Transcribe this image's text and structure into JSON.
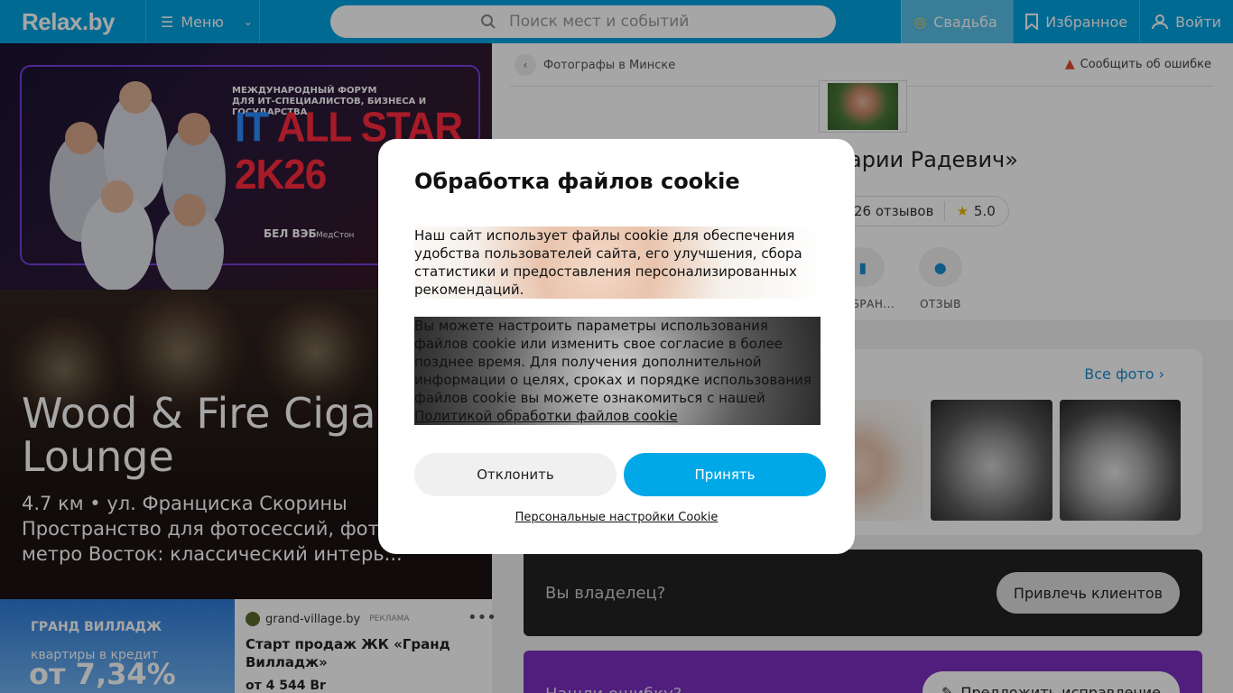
{
  "header": {
    "logo": "Relax.by",
    "menu_label": "Меню",
    "search_placeholder": "Поиск мест и событий",
    "wedding_label": "Свадьба",
    "favorites_label": "Избранное",
    "login_label": "Войти"
  },
  "banner": {
    "forum_line1": "МЕЖДУНАРОДНЫЙ ФОРУМ",
    "forum_line2": "ДЛЯ ИТ-СПЕЦИАЛИСТОВ, БИЗНЕСА И ГОСУДАРСТВА",
    "headline_it": "IT",
    "headline_rest": " ALL STAR 2K26",
    "sponsor": "БЕЛ ВЭБ",
    "sponsor2": "МедСтон"
  },
  "place": {
    "title": "Wood & Fire Cigar Lounge",
    "distance_address": "4.7 км • ул. Франциска Скорины",
    "description": "Пространство для фотосессий, фото возле метро Восток: классический интерь..."
  },
  "ad": {
    "image_brand": "ГРАНД ВИЛЛАДЖ",
    "image_credit": "квартиры в кредит",
    "image_rate": "от 7,34%",
    "source": "grand-village.by",
    "tag": "РЕКЛАМА",
    "more": "•••",
    "headline": "Старт продаж ЖК «Гранд Вилладж»",
    "price": "от 4 544 Br"
  },
  "profile": {
    "breadcrumb": "Фотографы в Минске",
    "report": "Сообщить об ошибке",
    "name": "арии Радевич»",
    "reviews": "26 отзывов",
    "rating": "5.0",
    "action_favorite": "ИЗБРАН...",
    "action_review": "ОТЗЫВ",
    "all_photos": "Все фото"
  },
  "owner": {
    "question": "Вы владелец?",
    "button": "Привлечь клиентов"
  },
  "errors": {
    "question": "Нашли ошибку?",
    "button": "Предложить исправление"
  },
  "cookie_modal": {
    "title": "Обработка файлов cookie",
    "paragraph1": "Наш сайт использует файлы cookie для обеспечения удобства пользователей сайта, его улучшения, сбора статистики и предоставления персонализированных рекомендаций.",
    "paragraph2": "Вы можете настроить параметры использования файлов cookie или изменить свое согласие в более позднее время. Для получения дополнительной информации о целях, сроках и порядке использования файлов cookie вы можете ознакомиться с нашей",
    "policy_link": "Политикой обработки файлов cookie",
    "decline": "Отклонить",
    "accept": "Принять",
    "custom_settings": "Персональные настройки Cookie"
  },
  "colors": {
    "brand": "#00a3e0",
    "accept": "#00a8e8",
    "owner_bg": "#222222",
    "errors_bg": "#7b2fbf"
  }
}
